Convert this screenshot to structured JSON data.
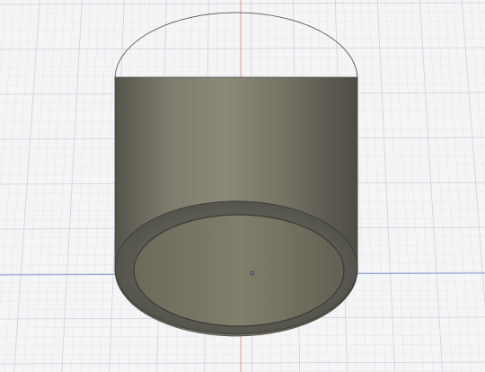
{
  "viewport": {
    "background": "#f4f5f6",
    "grid_minor_color": "#e3e6e9",
    "grid_major_color": "#cfd4d9"
  },
  "axes": {
    "x_axis_color": "#8fa3d6",
    "y_axis_color": "#e59a9a"
  },
  "model": {
    "shape": "hollow-cylinder",
    "body_color": "#6e6c61",
    "body_highlight": "#8a8878",
    "body_shadow": "#4e4d46",
    "rim_color": "#5b5a52",
    "inner_color": "#75735f",
    "edge_color": "#3e3d38",
    "origin_marker_icon": "origin-point-icon"
  }
}
